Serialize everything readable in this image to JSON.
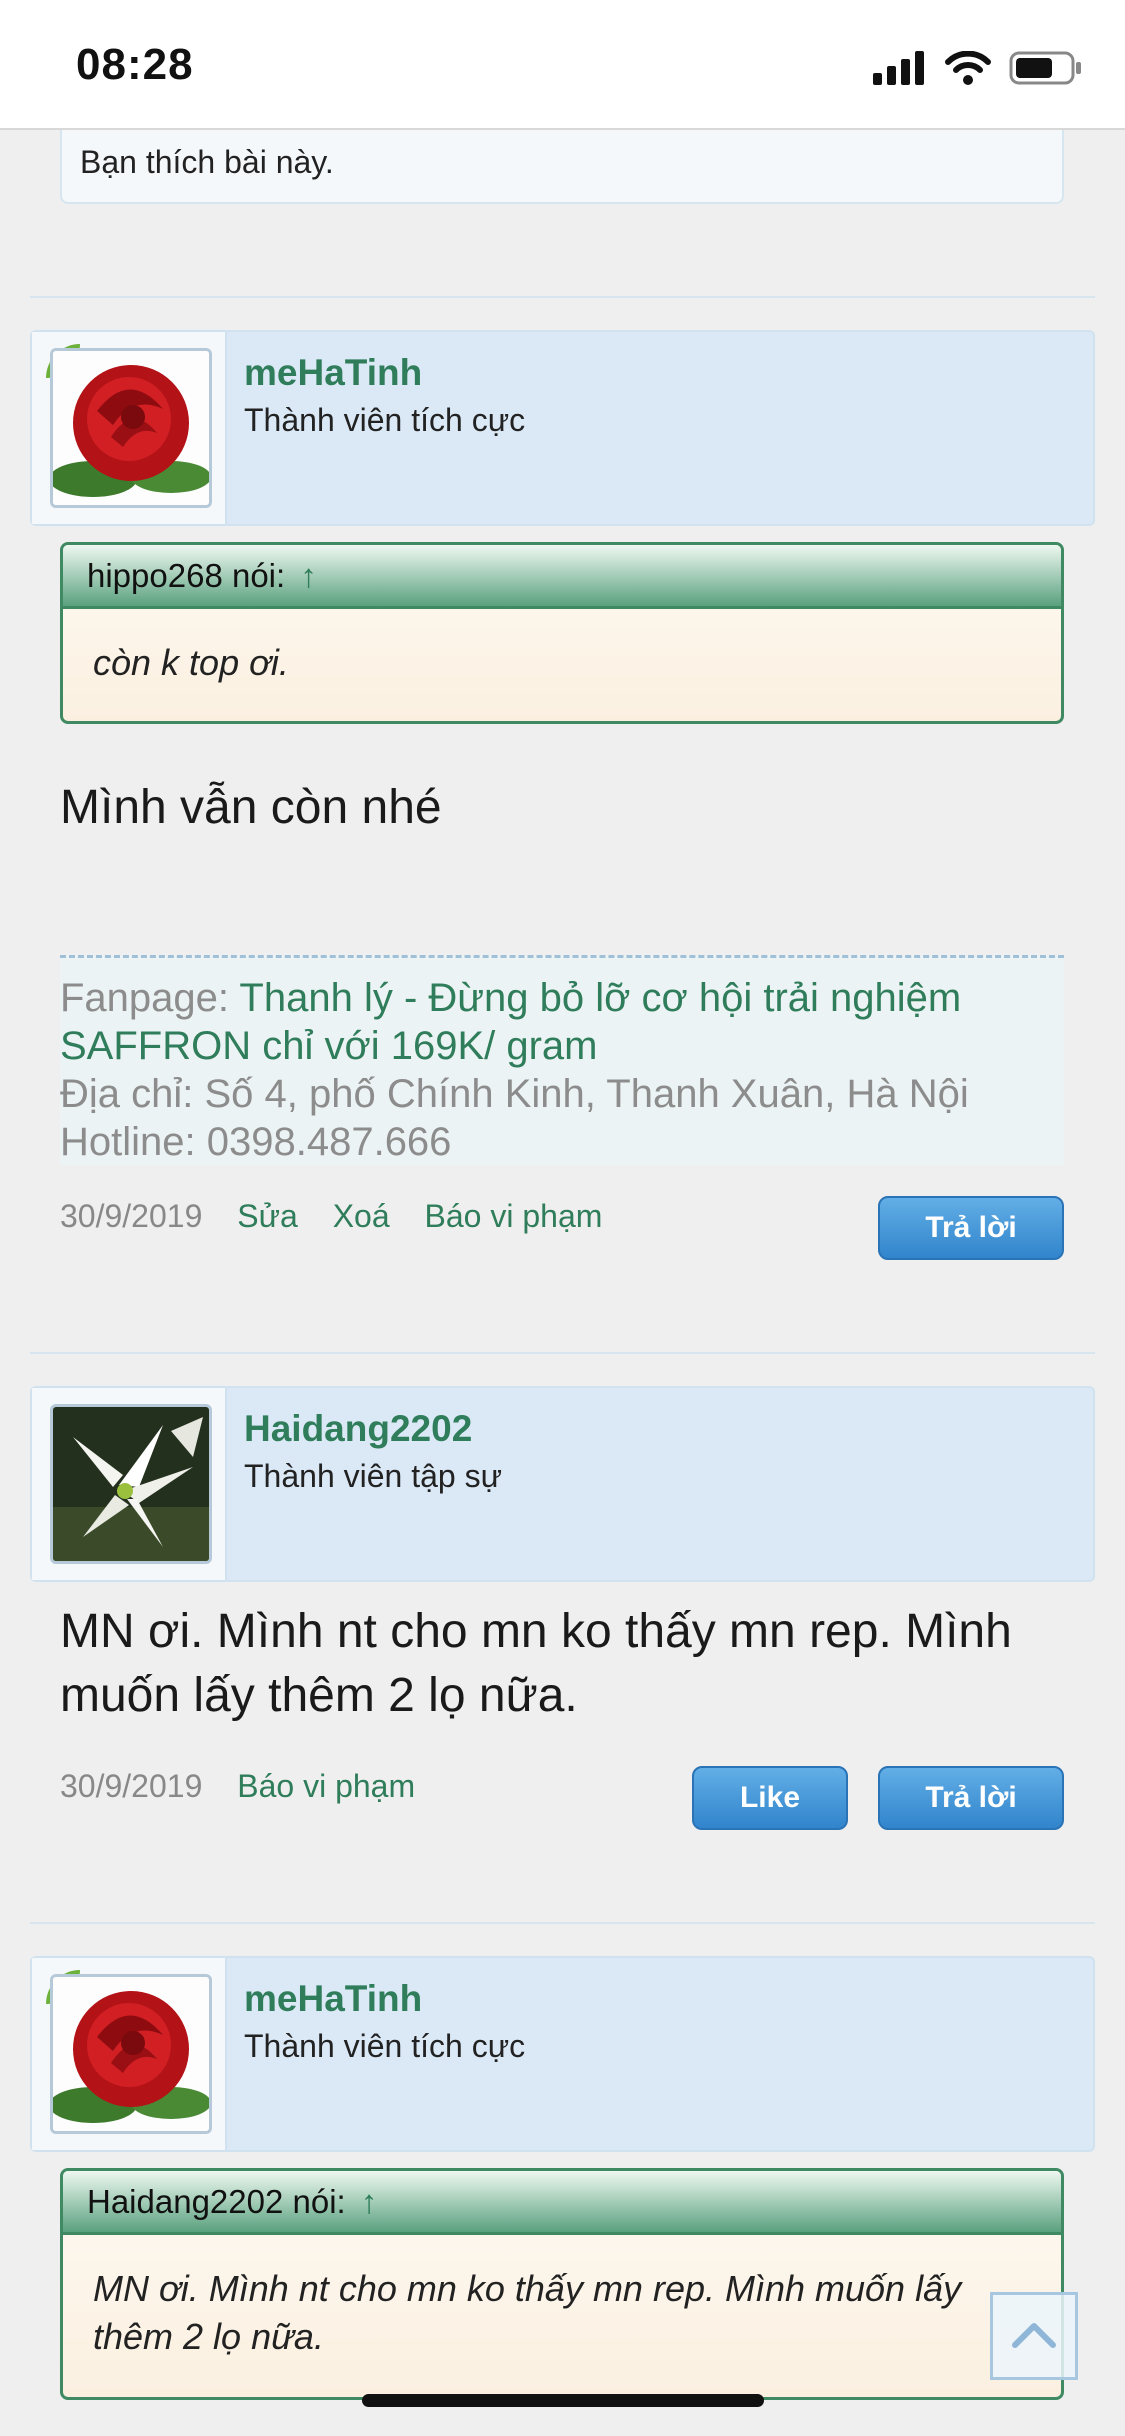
{
  "status": {
    "time": "08:28"
  },
  "liked_text": "Bạn thích bài này.",
  "posts": [
    {
      "username": "meHaTinh",
      "user_title": "Thành viên tích cực",
      "quote_author": "hippo268 nói:",
      "quote_arrow": "↑",
      "quote_text": "còn k top ơi.",
      "message": "Mình vẫn còn nhé",
      "signature": {
        "fanpage_label": "Fanpage: ",
        "fanpage_link": "Thanh lý - Đừng bỏ lỡ cơ hội trải nghiệm SAFFRON chỉ với 169K/ gram",
        "address": "Địa chỉ: Số 4, phố Chính Kinh, Thanh Xuân, Hà Nội",
        "hotline": "Hotline: 0398.487.666"
      },
      "date": "30/9/2019",
      "actions": [
        "Sửa",
        "Xoá",
        "Báo vi phạm"
      ],
      "reply_label": "Trả lời"
    },
    {
      "username": "Haidang2202",
      "user_title": "Thành viên tập sự",
      "message": "MN ơi. Mình nt cho mn ko thấy mn rep. Mình muốn lấy thêm 2 lọ nữa.",
      "date": "30/9/2019",
      "actions": [
        "Báo vi phạm"
      ],
      "like_label": "Like",
      "reply_label": "Trả lời"
    },
    {
      "username": "meHaTinh",
      "user_title": "Thành viên tích cực",
      "quote_author": "Haidang2202 nói:",
      "quote_arrow": "↑",
      "quote_text": "MN ơi. Mình nt cho mn ko thấy mn rep. Mình muốn lấy thêm 2 lọ nữa."
    }
  ]
}
